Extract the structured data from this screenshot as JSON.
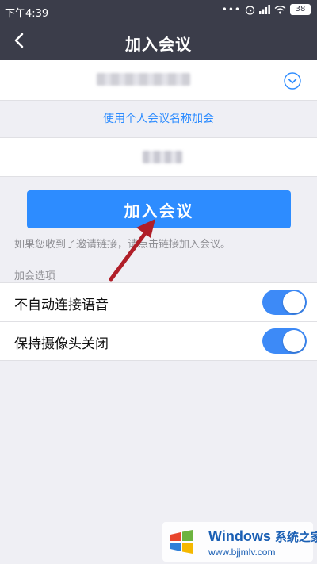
{
  "status_bar": {
    "time": "下午4:39",
    "battery": "38"
  },
  "nav": {
    "title": "加入会议"
  },
  "form": {
    "personal_link": "使用个人会议名称加会"
  },
  "join_button_label": "加入会议",
  "hint_text": "如果您收到了邀请链接，请点击链接加入会议。",
  "options": {
    "section_label": "加会选项",
    "items": [
      {
        "label": "不自动连接语音",
        "enabled": true
      },
      {
        "label": "保持摄像头关闭",
        "enabled": true
      }
    ]
  },
  "colors": {
    "header_bg": "#3b3d4a",
    "accent": "#2d8cff",
    "toggle_on": "#3d8af7",
    "annotation_arrow": "#b01e28"
  },
  "watermark": {
    "brand": "Windows",
    "brand_cn": "系统之家",
    "url": "www.bjjmlv.com"
  }
}
